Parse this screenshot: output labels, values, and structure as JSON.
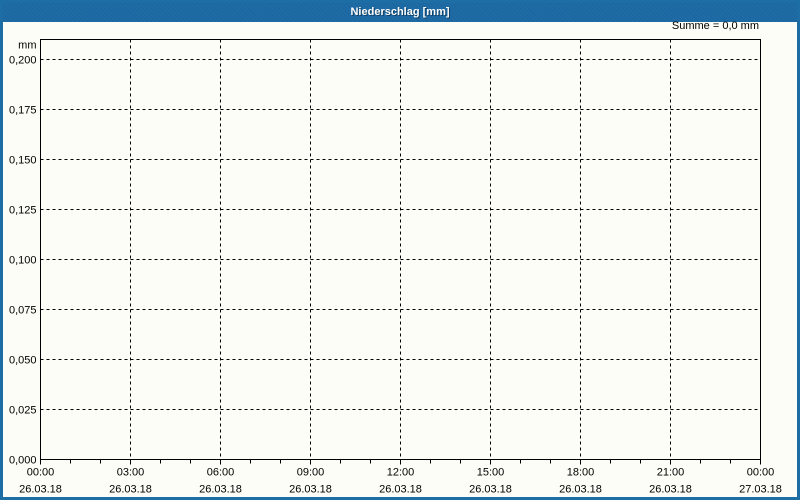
{
  "window": {
    "title": "Niederschlag [mm]",
    "colors": {
      "titlebar": "#1e6ba6",
      "border": "#1c6ea4",
      "background": "#fdfdf7",
      "grid": "#000000",
      "axis": "#000000",
      "text": "#000000",
      "title_text": "#ffffff"
    }
  },
  "summary": "Summe = 0,0 mm",
  "chart_data": {
    "type": "line",
    "title": "Niederschlag [mm]",
    "ylabel": "mm",
    "xlabel": "",
    "ylim": [
      0,
      0.21
    ],
    "grid": "dashed",
    "legend_position": "none",
    "y_ticks": [
      {
        "value": 0.0,
        "label": "0,000"
      },
      {
        "value": 0.025,
        "label": "0,025"
      },
      {
        "value": 0.05,
        "label": "0,050"
      },
      {
        "value": 0.075,
        "label": "0,075"
      },
      {
        "value": 0.1,
        "label": "0,100"
      },
      {
        "value": 0.125,
        "label": "0,125"
      },
      {
        "value": 0.15,
        "label": "0,150"
      },
      {
        "value": 0.175,
        "label": "0,175"
      },
      {
        "value": 0.2,
        "label": "0,200"
      }
    ],
    "x_ticks": [
      {
        "time": "00:00",
        "date": "26.03.18"
      },
      {
        "time": "03:00",
        "date": "26.03.18"
      },
      {
        "time": "06:00",
        "date": "26.03.18"
      },
      {
        "time": "09:00",
        "date": "26.03.18"
      },
      {
        "time": "12:00",
        "date": "26.03.18"
      },
      {
        "time": "15:00",
        "date": "26.03.18"
      },
      {
        "time": "18:00",
        "date": "26.03.18"
      },
      {
        "time": "21:00",
        "date": "26.03.18"
      },
      {
        "time": "00:00",
        "date": "27.03.18"
      }
    ],
    "x_minor_divisions": 3,
    "series": [
      {
        "name": "Niederschlag",
        "values": []
      }
    ],
    "annotations": [
      "Summe = 0,0 mm"
    ]
  }
}
